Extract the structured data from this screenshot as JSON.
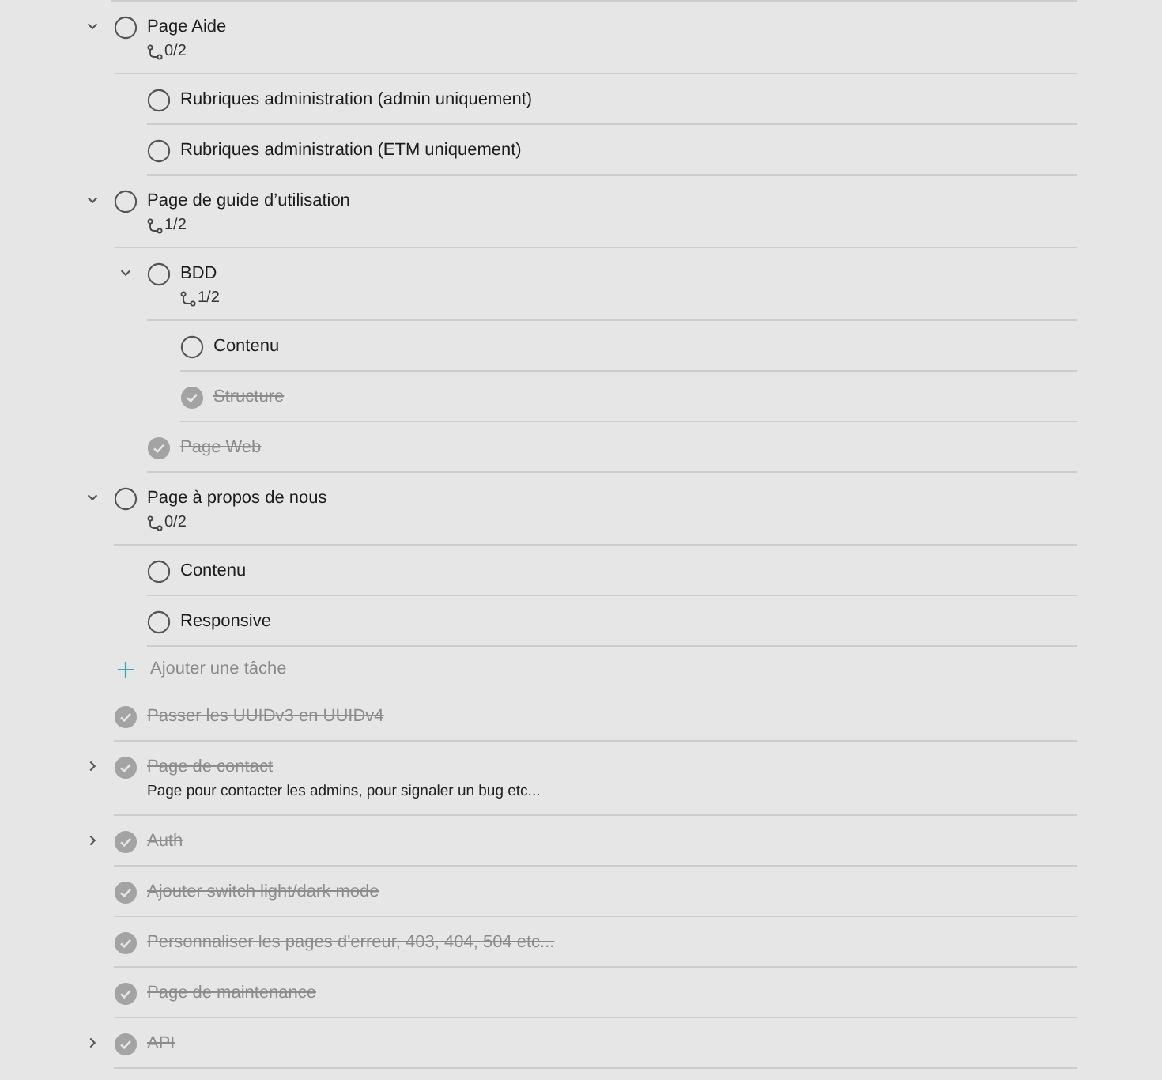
{
  "tasks": [
    {
      "kind": "task",
      "title": "Page Aide",
      "done": false,
      "expanded": true,
      "progress": "0/2",
      "children": [
        {
          "kind": "task",
          "title": "Rubriques administration (admin uniquement)",
          "done": false
        },
        {
          "kind": "task",
          "title": "Rubriques administration (ETM uniquement)",
          "done": false
        }
      ]
    },
    {
      "kind": "task",
      "title": "Page de guide d’utilisation",
      "done": false,
      "expanded": true,
      "progress": "1/2",
      "children": [
        {
          "kind": "task",
          "title": "BDD",
          "done": false,
          "expanded": true,
          "progress": "1/2",
          "children": [
            {
              "kind": "task",
              "title": "Contenu",
              "done": false
            },
            {
              "kind": "task",
              "title": "Structure",
              "done": true
            }
          ]
        },
        {
          "kind": "task",
          "title": "Page Web",
          "done": true
        }
      ]
    },
    {
      "kind": "task",
      "title": "Page à propos de nous",
      "done": false,
      "expanded": true,
      "progress": "0/2",
      "children": [
        {
          "kind": "task",
          "title": "Contenu",
          "done": false
        },
        {
          "kind": "task",
          "title": "Responsive",
          "done": false
        }
      ]
    },
    {
      "kind": "add",
      "title": "Ajouter une tâche"
    },
    {
      "kind": "task",
      "title": "Passer les UUIDv3 en UUIDv4",
      "done": true
    },
    {
      "kind": "task",
      "title": "Page de contact",
      "done": true,
      "expanded": false,
      "note": "Page pour contacter les admins, pour signaler un bug etc..."
    },
    {
      "kind": "task",
      "title": "Auth",
      "done": true,
      "expanded": false
    },
    {
      "kind": "task",
      "title": "Ajouter switch light/dark mode",
      "done": true
    },
    {
      "kind": "task",
      "title": "Personnaliser les pages d'erreur, 403, 404, 504 etc...",
      "done": true
    },
    {
      "kind": "task",
      "title": "Page de maintenance",
      "done": true
    },
    {
      "kind": "task",
      "title": "API",
      "done": true,
      "expanded": false
    }
  ]
}
